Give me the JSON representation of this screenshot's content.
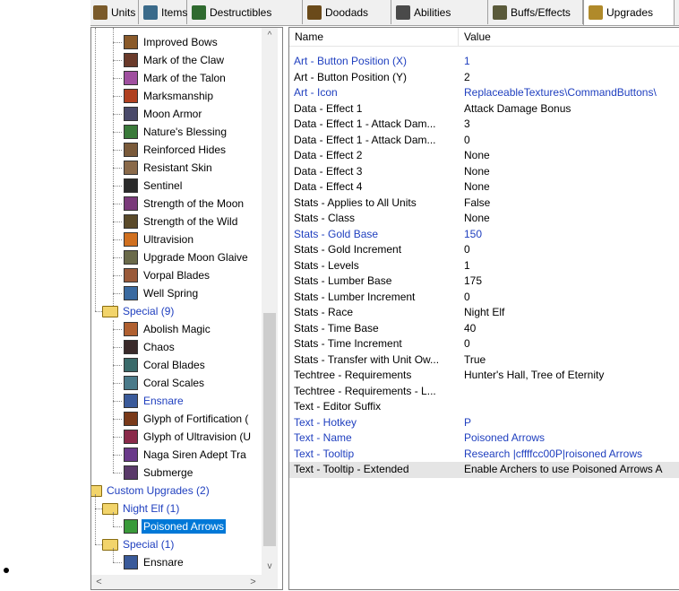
{
  "tabs": [
    {
      "label": "Units",
      "icon": "units-icon",
      "color": "#7a5a2a"
    },
    {
      "label": "Items",
      "icon": "items-icon",
      "color": "#3a6a8a"
    },
    {
      "label": "Destructibles",
      "icon": "destructibles-icon",
      "color": "#2f6a2f"
    },
    {
      "label": "Doodads",
      "icon": "doodads-icon",
      "color": "#6a4a1a"
    },
    {
      "label": "Abilities",
      "icon": "abilities-icon",
      "color": "#4a4a4a"
    },
    {
      "label": "Buffs/Effects",
      "icon": "buffs-icon",
      "color": "#5a5a3a"
    },
    {
      "label": "Upgrades",
      "icon": "upgrades-icon",
      "color": "#b08a2a"
    }
  ],
  "tree": {
    "standard_items": [
      {
        "label": "Improved Bows",
        "color": "#8a5a2a"
      },
      {
        "label": "Mark of the Claw",
        "color": "#6a3a2a"
      },
      {
        "label": "Mark of the Talon",
        "color": "#a050a0"
      },
      {
        "label": "Marksmanship",
        "color": "#b04020"
      },
      {
        "label": "Moon Armor",
        "color": "#4a4a6a"
      },
      {
        "label": "Nature's Blessing",
        "color": "#3a7a3a"
      },
      {
        "label": "Reinforced Hides",
        "color": "#7a5a3a"
      },
      {
        "label": "Resistant Skin",
        "color": "#8a6a4a"
      },
      {
        "label": "Sentinel",
        "color": "#2a2a2a"
      },
      {
        "label": "Strength of the Moon",
        "color": "#7a3a7a"
      },
      {
        "label": "Strength of the Wild",
        "color": "#5a4a2a"
      },
      {
        "label": "Ultravision",
        "color": "#d07020"
      },
      {
        "label": "Upgrade Moon Glaive",
        "color": "#6a6a4a"
      },
      {
        "label": "Vorpal Blades",
        "color": "#9a5a3a"
      },
      {
        "label": "Well Spring",
        "color": "#3a6aa0"
      }
    ],
    "special_folder": "Special (9)",
    "special_items": [
      {
        "label": "Abolish Magic",
        "color": "#b06030"
      },
      {
        "label": "Chaos",
        "color": "#3a2a2a"
      },
      {
        "label": "Coral Blades",
        "color": "#3a6a6a"
      },
      {
        "label": "Coral Scales",
        "color": "#4a7a8a"
      },
      {
        "label": "Ensnare",
        "color": "#3a5a9a",
        "modified": true
      },
      {
        "label": "Glyph of Fortification (",
        "color": "#7a3a1a"
      },
      {
        "label": "Glyph of Ultravision (U",
        "color": "#8a2a4a"
      },
      {
        "label": "Naga Siren Adept Tra",
        "color": "#6a3a8a"
      },
      {
        "label": "Submerge",
        "color": "#5a3a6a"
      }
    ],
    "custom_root": "Custom Upgrades (2)",
    "custom_nightelf": "Night Elf (1)",
    "custom_nightelf_item": {
      "label": "Poisoned Arrows",
      "color": "#3a9a3a"
    },
    "custom_special": "Special (1)",
    "custom_special_item": {
      "label": "Ensnare",
      "color": "#3a5a9a"
    }
  },
  "props": {
    "header_name": "Name",
    "header_value": "Value",
    "rows": [
      {
        "name": "Art - Button Position (X)",
        "value": "1",
        "mod": true
      },
      {
        "name": "Art - Button Position (Y)",
        "value": "2",
        "mod": false
      },
      {
        "name": "Art - Icon",
        "value": "ReplaceableTextures\\CommandButtons\\",
        "mod": true
      },
      {
        "name": "Data - Effect 1",
        "value": "Attack Damage Bonus",
        "mod": false
      },
      {
        "name": "Data - Effect 1 - Attack Dam...",
        "value": "3",
        "mod": false
      },
      {
        "name": "Data - Effect 1 - Attack Dam...",
        "value": "0",
        "mod": false
      },
      {
        "name": "Data - Effect 2",
        "value": "None",
        "mod": false
      },
      {
        "name": "Data - Effect 3",
        "value": "None",
        "mod": false
      },
      {
        "name": "Data - Effect 4",
        "value": "None",
        "mod": false
      },
      {
        "name": "Stats - Applies to All Units",
        "value": "False",
        "mod": false
      },
      {
        "name": "Stats - Class",
        "value": "None",
        "mod": false
      },
      {
        "name": "Stats - Gold Base",
        "value": "150",
        "mod": true
      },
      {
        "name": "Stats - Gold Increment",
        "value": "0",
        "mod": false
      },
      {
        "name": "Stats - Levels",
        "value": "1",
        "mod": false
      },
      {
        "name": "Stats - Lumber Base",
        "value": "175",
        "mod": false
      },
      {
        "name": "Stats - Lumber Increment",
        "value": "0",
        "mod": false
      },
      {
        "name": "Stats - Race",
        "value": "Night Elf",
        "mod": false
      },
      {
        "name": "Stats - Time Base",
        "value": "40",
        "mod": false
      },
      {
        "name": "Stats - Time Increment",
        "value": "0",
        "mod": false
      },
      {
        "name": "Stats - Transfer with Unit Ow...",
        "value": "True",
        "mod": false
      },
      {
        "name": "Techtree - Requirements",
        "value": "Hunter's Hall, Tree of Eternity",
        "mod": false
      },
      {
        "name": "Techtree - Requirements - L...",
        "value": "",
        "mod": false
      },
      {
        "name": "Text - Editor Suffix",
        "value": "",
        "mod": false
      },
      {
        "name": "Text - Hotkey",
        "value": "P",
        "mod": true
      },
      {
        "name": "Text - Name",
        "value": "Poisoned Arrows",
        "mod": true
      },
      {
        "name": "Text - Tooltip",
        "value": "Research |cffffcc00P|roisoned Arrows",
        "mod": true
      },
      {
        "name": "Text - Tooltip - Extended",
        "value": "Enable Archers to use Poisoned Arrows A",
        "mod": false,
        "highlight": true
      }
    ]
  },
  "scroll": {
    "up": "^",
    "down": "v",
    "left": "<",
    "right": ">"
  }
}
